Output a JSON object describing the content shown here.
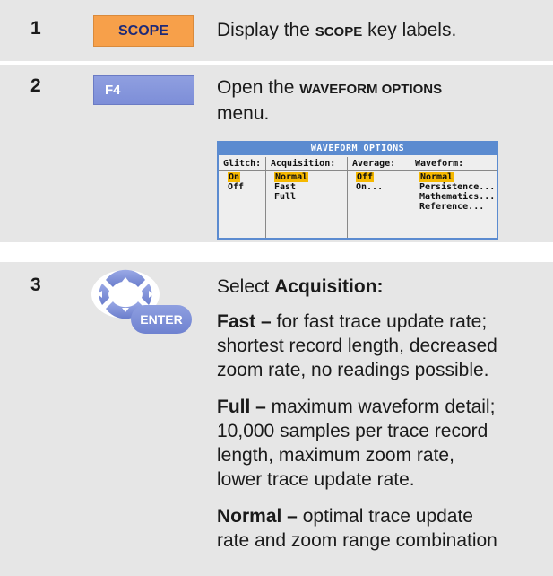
{
  "steps": [
    {
      "num": "1",
      "key_label": "SCOPE",
      "desc_pre": "Display the ",
      "desc_key": "SCOPE",
      "desc_post": " key labels."
    },
    {
      "num": "2",
      "key_label": "F4",
      "desc_pre": "Open the ",
      "desc_key": "WAVEFORM OPTIONS",
      "desc_post": "menu."
    },
    {
      "num": "3",
      "key_label": "ENTER",
      "desc_pre": "Select ",
      "desc_key": "Acquisition:"
    }
  ],
  "menu": {
    "title": "WAVEFORM OPTIONS",
    "glitch": {
      "header": "Glitch:",
      "items": [
        "On",
        "Off"
      ]
    },
    "acquisition": {
      "header": "Acquisition:",
      "items": [
        "Normal",
        "Fast",
        "Full"
      ]
    },
    "average": {
      "header": "Average:",
      "items": [
        "Off",
        "On..."
      ]
    },
    "waveform": {
      "header": "Waveform:",
      "items": [
        "Normal",
        "Persistence...",
        "Mathematics...",
        "Reference..."
      ]
    }
  },
  "paragraphs": [
    {
      "term": "Fast –",
      "lines": [
        " for fast trace update rate;",
        "shortest record length, decreased",
        "zoom rate, no readings possible."
      ]
    },
    {
      "term": "Full –",
      "lines": [
        " maximum waveform detail;",
        "10,000 samples per trace record",
        "length, maximum zoom rate,",
        "lower trace update rate."
      ]
    },
    {
      "term": "Normal –",
      "lines": [
        " optimal trace update",
        "rate and zoom range combination"
      ]
    }
  ],
  "colors": {
    "row_bg": "#e6e6e6",
    "scope_key": "#f7a04a",
    "blue_key": "#7d8ed8",
    "menu_border": "#5b8bd0",
    "highlight": "#f5b800"
  }
}
